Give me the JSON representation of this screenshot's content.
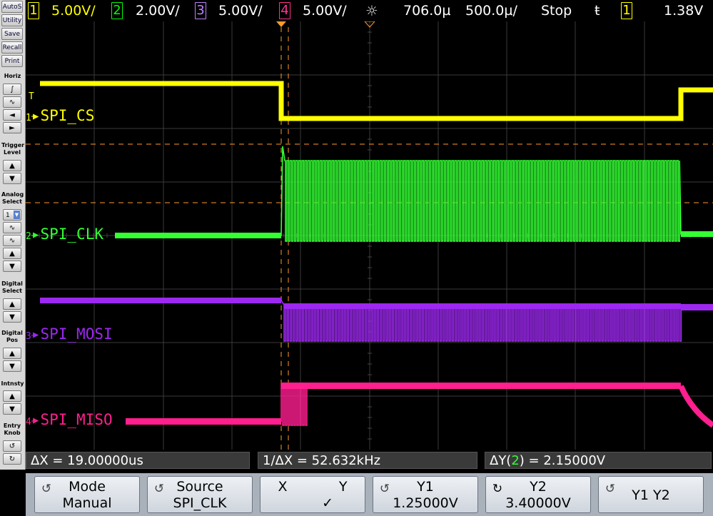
{
  "top_bar": {
    "ch1": {
      "num": "1",
      "scale": "5.00V/",
      "color": "#ffff00"
    },
    "ch2": {
      "num": "2",
      "scale": "2.00V/",
      "color": "#00ff00"
    },
    "ch3": {
      "num": "3",
      "scale": "5.00V/",
      "color": "#a020f0"
    },
    "ch4": {
      "num": "4",
      "scale": "5.00V/",
      "color": "#ff2080"
    },
    "time_pos": "706.0µ",
    "time_scale": "500.0µ/",
    "run_state": "Stop",
    "trigger_icon": "ŧ",
    "trig_channel": "1",
    "trig_level": "1.38V"
  },
  "left_panel": {
    "buttons": [
      "AutoS",
      "Utility",
      "Save",
      "Recall",
      "Print"
    ],
    "horiz_label": "Horiz",
    "trigger_level_label": "Trigger Level",
    "analog_select_label": "Analog Select",
    "analog_select_value": "1",
    "digital_select_label": "Digital Select",
    "digital_pos_label": "Digital Pos",
    "intensity_label": "Intnsty",
    "entry_knob_label": "Entry Knob"
  },
  "channels": {
    "ch1": {
      "marker": "1",
      "label": "SPI_CS",
      "color": "#ffff00"
    },
    "ch2": {
      "marker": "2",
      "label": "SPI_CLK",
      "color": "#33ff33"
    },
    "ch3": {
      "marker": "3",
      "label": "SPI_MOSI",
      "color": "#9d28f0"
    },
    "ch4": {
      "marker": "4",
      "label": "SPI_MISO",
      "color": "#ff1f8f"
    }
  },
  "trigger_marker": "T",
  "measurements": {
    "delta_x": "ΔX = 19.00000us",
    "inv_delta_x": "1/ΔX = 52.632kHz",
    "delta_y_prefix": "ΔY(",
    "delta_y_channel": "2",
    "delta_y_suffix": ") = 2.15000V"
  },
  "softkeys": [
    {
      "line1": "Mode",
      "line2": "Manual",
      "knob": true
    },
    {
      "line1": "Source",
      "line2": "SPI_CLK",
      "knob": true
    },
    {
      "line1": "X            Y",
      "line2": "✓",
      "knob": false
    },
    {
      "line1": "Y1",
      "line2": "1.25000V",
      "knob": true
    },
    {
      "line1": "Y2",
      "line2": "3.40000V",
      "knob": true
    },
    {
      "line1": "",
      "line2": "Y1 Y2",
      "knob": true
    }
  ],
  "icons": {
    "knob": "↺",
    "up": "▲",
    "down": "▼",
    "left": "◄",
    "right": "►",
    "pulse": "∫",
    "wave": "∿"
  }
}
